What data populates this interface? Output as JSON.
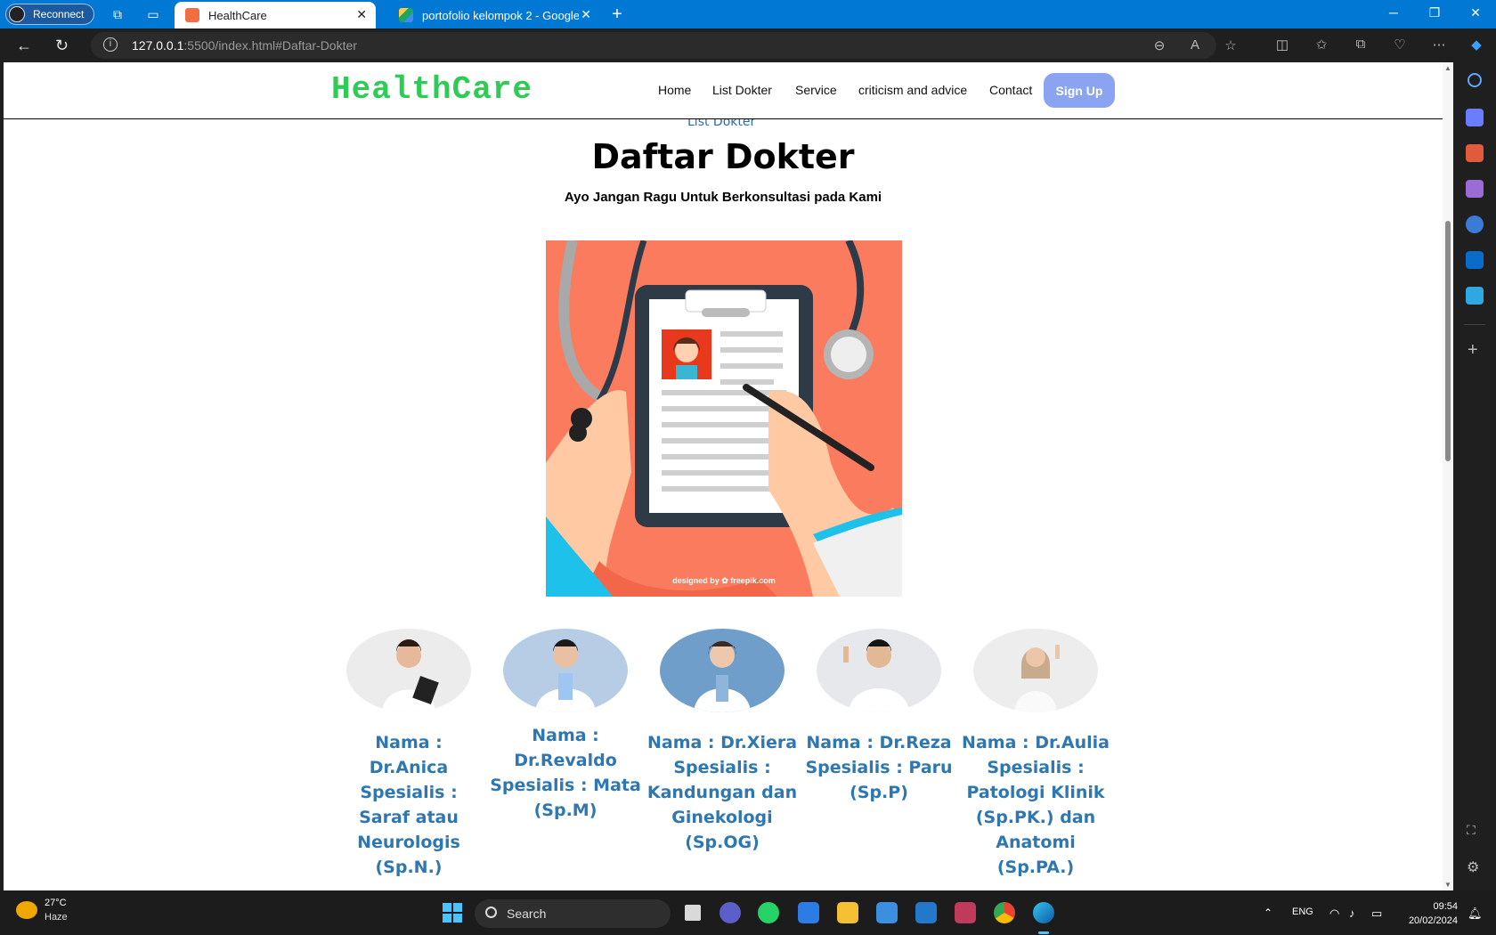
{
  "browser": {
    "reconnect_label": "Reconnect",
    "tabs": [
      {
        "title": "HealthCare",
        "active": true
      },
      {
        "title": "portofolio kelompok 2 - Google",
        "active": false
      }
    ],
    "url_host": "127.0.0.1",
    "url_rest": ":5500/index.html#Daftar-Dokter"
  },
  "site": {
    "brand": "HealthCare",
    "nav": [
      "Home",
      "List Dokter",
      "Service",
      "criticism and advice",
      "Contact"
    ],
    "signup_label": "Sign Up",
    "section_peek": "List Dokter",
    "heading": "Daftar Dokter",
    "subheading": "Ayo Jangan Ragu Untuk Berkonsultasi pada Kami",
    "hero_credit": "designed by ✿ freepik.com",
    "doctors": [
      {
        "text": "Nama : Dr.Anica Spesialis : Saraf atau Neurologis (Sp.N.)"
      },
      {
        "text": "Nama : Dr.Revaldo Spesialis : Mata (Sp.M)"
      },
      {
        "text": "Nama : Dr.Xiera Spesialis : Kandungan dan Ginekologi (Sp.OG)"
      },
      {
        "text": "Nama : Dr.Reza Spesialis : Paru (Sp.P)"
      },
      {
        "text": "Nama : Dr.Aulia Spesialis : Patologi Klinik (Sp.PK.) dan Anatomi (Sp.PA.)"
      }
    ]
  },
  "taskbar": {
    "temperature": "27°C",
    "condition": "Haze",
    "search_placeholder": "Search",
    "language": "ENG",
    "time": "09:54",
    "date": "20/02/2024"
  },
  "colors": {
    "brand": "#2ecc55",
    "signup_bg": "#8aa4f2",
    "doctor_text": "#2f77b0",
    "hero_bg": "#fa7b5d",
    "edge_accent": "#0078d4"
  }
}
